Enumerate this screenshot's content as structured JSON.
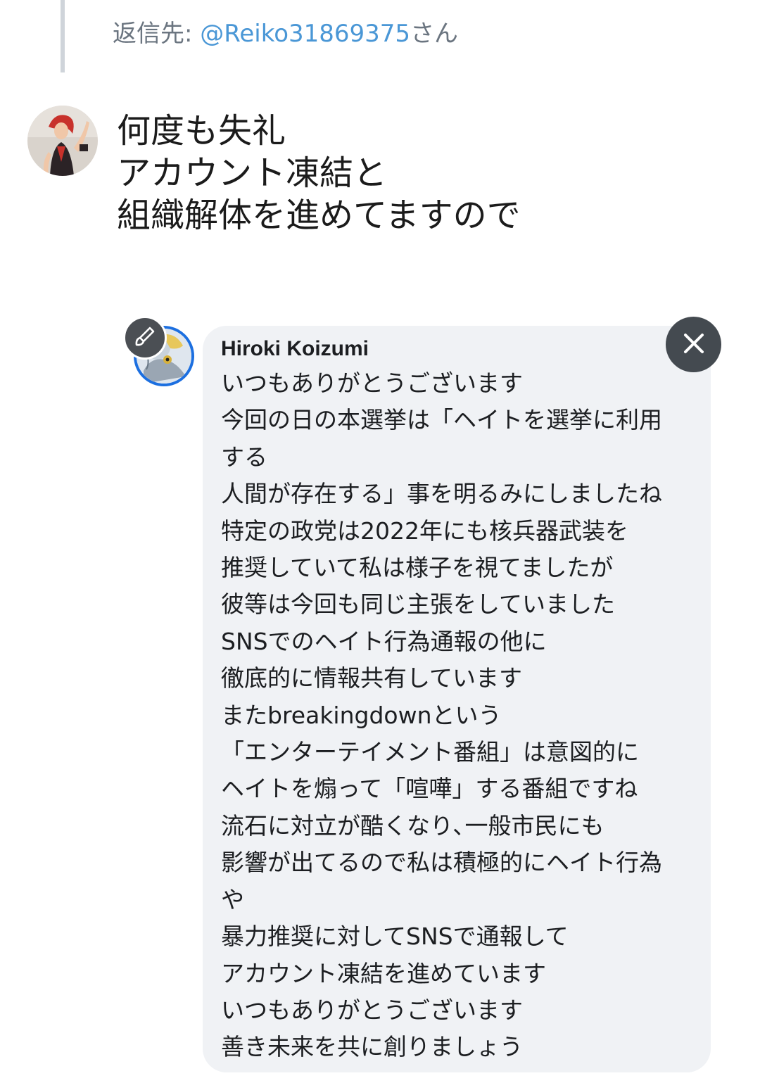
{
  "reply": {
    "prefix": "返信先: ",
    "handle": "@Reiko31869375",
    "suffix": "さん"
  },
  "tweet": {
    "lines": [
      "何度も失礼",
      "アカウント凍結と",
      "組織解体を進めてますので"
    ]
  },
  "comment": {
    "author": "Hiroki Koizumi",
    "lines": [
      "いつもありがとうございます",
      "今回の日の本選挙は「ヘイトを選挙に利用",
      "する",
      "人間が存在する」事を明るみにしましたね",
      "特定の政党は2022年にも核兵器武装を",
      "推奨していて私は様子を視てましたが",
      "彼等は今回も同じ主張をしていました",
      "SNSでのヘイト行為通報の他に",
      "徹底的に情報共有しています",
      "またbreakingdownという",
      "「エンターテイメント番組」は意図的に",
      "ヘイトを煽って「喧嘩」する番組ですね",
      "流石に対立が酷くなり､一般市民にも",
      "影響が出てるので私は積極的にヘイト行為",
      "や",
      "暴力推奨に対してSNSで通報して",
      "アカウント凍結を進めています",
      "いつもありがとうございます",
      "善き未来を共に創りましょう"
    ]
  },
  "icons": {
    "edit": "brush-icon",
    "close": "close-icon"
  },
  "colors": {
    "link": "#4a97d6",
    "bubble_bg": "#f0f2f5",
    "avatar_ring": "#1c6fe0",
    "button_bg": "#444a50"
  }
}
